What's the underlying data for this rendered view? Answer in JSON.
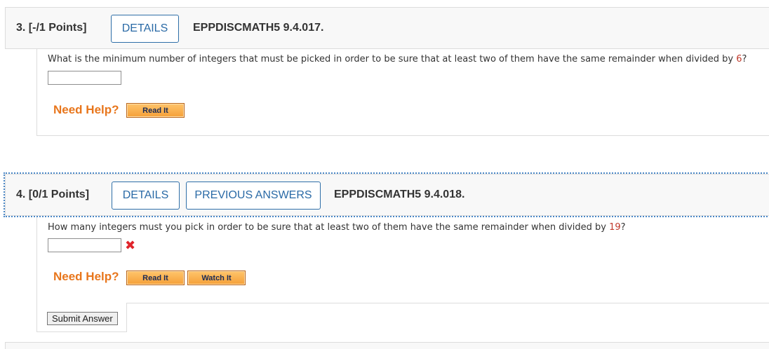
{
  "q3": {
    "number_label": "3. [-/1 Points]",
    "details_label": "DETAILS",
    "code": "EPPDISCMATH5 9.4.017.",
    "question_text": "What is the minimum number of integers that must be picked in order to be sure that at least two of them have the same remainder when divided by ",
    "question_number": "6",
    "question_end": "?",
    "answer_value": "",
    "need_help_label": "Need Help?",
    "read_it_label": "Read It"
  },
  "q4": {
    "number_label": "4. [0/1 Points]",
    "details_label": "DETAILS",
    "previous_answers_label": "PREVIOUS ANSWERS",
    "code": "EPPDISCMATH5 9.4.018.",
    "question_text": "How many integers must you pick in order to be sure that at least two of them have the same remainder when divided by ",
    "question_number": "19",
    "question_end": "?",
    "answer_value": "",
    "incorrect_mark": "✖",
    "need_help_label": "Need Help?",
    "read_it_label": "Read It",
    "watch_it_label": "Watch It",
    "submit_label": "Submit Answer"
  },
  "colors": {
    "accent_blue": "#2a6aa6",
    "need_help_orange": "#e8761c",
    "incorrect_red": "#e0242b",
    "highlight_number": "#c0392b"
  }
}
